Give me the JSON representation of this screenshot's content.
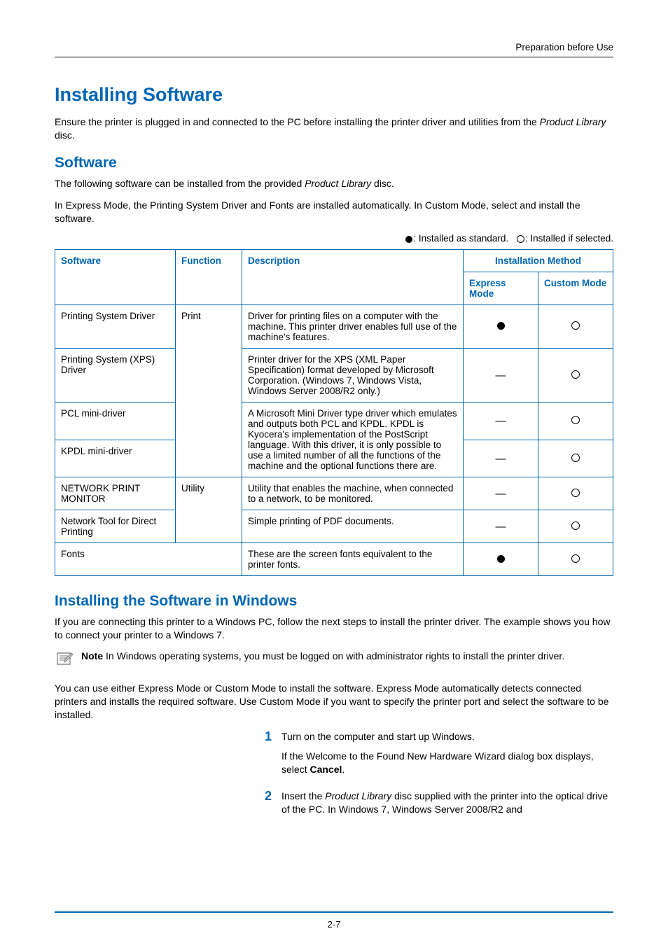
{
  "header": {
    "running_head": "Preparation before Use"
  },
  "section": {
    "title": "Installing Software",
    "intro_a": "Ensure the printer is plugged in and connected to the PC before installing the printer driver and utilities from the ",
    "intro_em": "Product Library",
    "intro_b": " disc."
  },
  "software": {
    "heading": "Software",
    "p1_a": "The following software can be installed from the provided ",
    "p1_em": "Product Library",
    "p1_b": " disc.",
    "p2": "In Express Mode, the Printing System Driver and Fonts are installed automatically. In Custom Mode, select and install the software.",
    "legend_std": ": Installed as standard.  ",
    "legend_sel": ": Installed if selected."
  },
  "table": {
    "h_software": "Software",
    "h_function": "Function",
    "h_description": "Description",
    "h_method": "Installation Method",
    "h_express": "Express Mode",
    "h_custom": "Custom Mode",
    "rows": [
      {
        "software": "Printing System Driver",
        "function": "Print",
        "description": "Driver for printing files on a computer with the machine. This printer driver enables full use of the machine's features.",
        "express": "filled",
        "custom": "hollow"
      },
      {
        "software": "Printing System (XPS) Driver",
        "function": "",
        "description": "Printer driver for the XPS (XML Paper Specification) format developed by Microsoft Corporation. (Windows 7, Windows Vista, Windows Server 2008/R2 only.)",
        "express": "dash",
        "custom": "hollow"
      },
      {
        "software": "PCL mini-driver",
        "function": "",
        "description": "A Microsoft Mini Driver type driver which emulates and outputs both PCL and KPDL. KPDL is Kyocera's implementation of the PostScript language. With this driver, it is only possible to use a limited number of all the functions of the machine and the optional functions there are.",
        "express": "dash",
        "custom": "hollow"
      },
      {
        "software": "KPDL mini-driver",
        "function": "",
        "description": "",
        "express": "dash",
        "custom": "hollow"
      },
      {
        "software": "NETWORK PRINT MONITOR",
        "function": "Utility",
        "description": "Utility that enables the machine, when connected to a network, to be monitored.",
        "express": "dash",
        "custom": "hollow"
      },
      {
        "software": "Network Tool for Direct Printing",
        "function": "",
        "description": "Simple printing of PDF documents.",
        "express": "dash",
        "custom": "hollow"
      },
      {
        "software": "Fonts",
        "function": "",
        "description": "These are the screen fonts equivalent to the printer fonts.",
        "express": "filled",
        "custom": "hollow"
      }
    ]
  },
  "install_win": {
    "heading": "Installing the Software in Windows",
    "p1": "If you are connecting this printer to a Windows PC, follow the next steps to install the printer driver. The example shows you how to connect your printer to a Windows 7.",
    "note_bold": "Note",
    "note_rest": "  In Windows operating systems, you must be logged on with administrator rights to install the printer driver.",
    "p2": "You can use either Express Mode or Custom Mode to install the software. Express Mode automatically detects connected printers and installs the required software. Use Custom Mode if you want to specify the printer port and select the software to be installed.",
    "steps": [
      {
        "num": "1",
        "para1": "Turn on the computer and start up Windows.",
        "para2_a": "If the Welcome to the Found New Hardware Wizard dialog box displays, select ",
        "para2_b": "Cancel",
        "para2_c": "."
      },
      {
        "num": "2",
        "para1_a": "Insert the ",
        "para1_em": "Product Library",
        "para1_b": " disc supplied with the printer into the optical drive of the PC. In Windows 7, Windows Server 2008/R2 and"
      }
    ]
  },
  "footer": {
    "page": "2-7"
  }
}
